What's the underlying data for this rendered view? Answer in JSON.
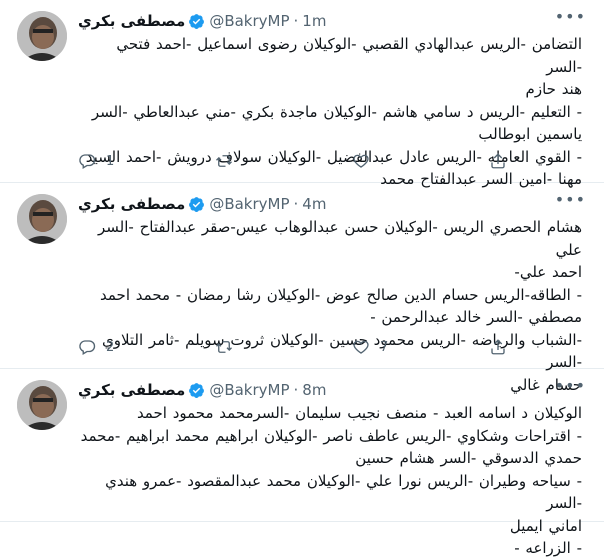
{
  "tweets": [
    {
      "name": "مصطفى بكري",
      "handle": "@BakryMP",
      "dot": "·",
      "time": "1m",
      "lines": [
        "التضامن -الريس عبدالهادي القصبي -الوكيلان رضوى اسماعيل -احمد فتحي -السر",
        "هند حازم",
        "- التعليم -الريس د سامي هاشم -الوكيلان ماجدة بكري -مني عبدالعاطي -السر",
        "ياسمين ابوطالب",
        "- القوي العامله -الريس عادل عبدالفضيل -الوكيلان سولاف درويش -احمد السيد",
        "مهنا -امين السر عبدالفتاح محمد"
      ],
      "replies": "1",
      "retweets": "",
      "likes": ""
    },
    {
      "name": "مصطفى بكري",
      "handle": "@BakryMP",
      "dot": "·",
      "time": "4m",
      "lines": [
        "هشام الحصري الريس -الوكيلان حسن عبدالوهاب عيس-صقر عبدالفتاح -السر علي",
        "احمد علي-",
        "- الطاقه-الريس حسام الدين صالح عوض -الوكيلان رشا رمضان - محمد احمد",
        "مصطفي -السر خالد عبدالرحمن -",
        "-الشباب والرياضه -الريس محمود حسين -الوكيلان ثروت سويلم -ثامر التلاوي -السر",
        "حسام غالي"
      ],
      "replies": "2",
      "retweets": "",
      "likes": "7"
    },
    {
      "name": "مصطفى بكري",
      "handle": "@BakryMP",
      "dot": "·",
      "time": "8m",
      "lines": [
        "الوكيلان د اسامه العبد - منصف نجيب سليمان -السرمحمد محمود احمد",
        "- اقتراحات وشكاوي -الريس عاطف ناصر -الوكيلان ابراهيم محمد ابراهيم -محمد",
        "حمدي الدسوقي -السر هشام حسين",
        "- سياحه وطيران -الريس نورا علي -الوكيلان محمد عبدالمقصود -عمرو هندي -السر",
        "اماني ايميل",
        "- الزراعه -"
      ],
      "replies": "",
      "retweets": "",
      "likes": ""
    }
  ],
  "colors": {
    "verified": "#1d9bf0",
    "secondary": "#536471",
    "border": "#e6ecf0"
  },
  "icons": [
    "verified-badge-icon",
    "more-icon",
    "reply-icon",
    "retweet-icon",
    "like-icon",
    "share-icon"
  ]
}
